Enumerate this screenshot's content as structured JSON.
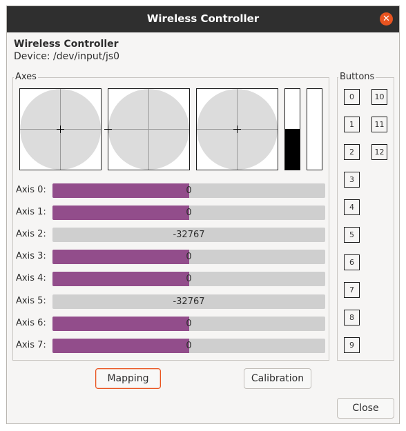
{
  "window": {
    "title": "Wireless Controller",
    "close_icon": "window-close-icon"
  },
  "header": {
    "title": "Wireless Controller",
    "device": "Device: /dev/input/js0"
  },
  "axes_frame": {
    "label": "Axes"
  },
  "buttons_frame": {
    "label": "Buttons"
  },
  "vbars": [
    {
      "level": 0.5
    },
    {
      "level": 0
    }
  ],
  "axes": [
    {
      "label": "Axis 0:",
      "value": "0",
      "fill": 0.5
    },
    {
      "label": "Axis 1:",
      "value": "0",
      "fill": 0.5
    },
    {
      "label": "Axis 2:",
      "value": "-32767",
      "fill": 0
    },
    {
      "label": "Axis 3:",
      "value": "0",
      "fill": 0.5
    },
    {
      "label": "Axis 4:",
      "value": "0",
      "fill": 0.5
    },
    {
      "label": "Axis 5:",
      "value": "-32767",
      "fill": 0
    },
    {
      "label": "Axis 6:",
      "value": "0",
      "fill": 0.5
    },
    {
      "label": "Axis 7:",
      "value": "0",
      "fill": 0.5
    }
  ],
  "buttons": [
    "0",
    "1",
    "2",
    "3",
    "4",
    "5",
    "6",
    "7",
    "8",
    "9",
    "10",
    "11",
    "12"
  ],
  "actions": {
    "mapping": "Mapping",
    "calibration": "Calibration",
    "close": "Close"
  },
  "colors": {
    "axis_fill": "#924d8b",
    "track": "#cfcfcf",
    "accent": "#e95420"
  }
}
